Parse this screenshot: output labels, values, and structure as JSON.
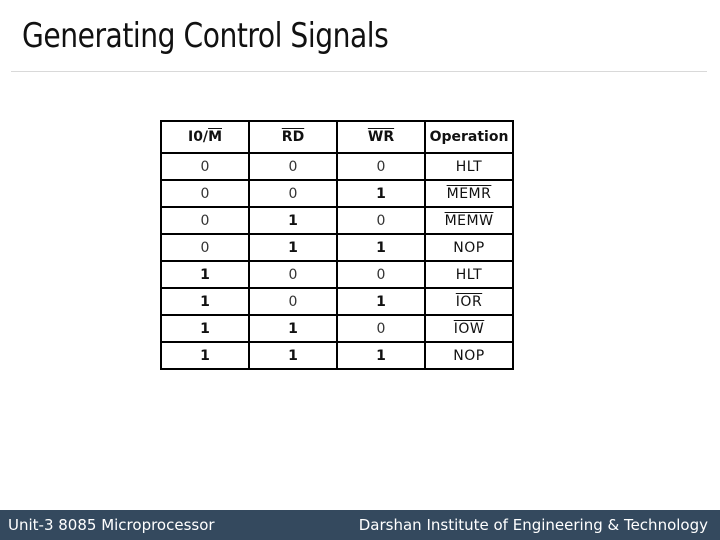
{
  "slide": {
    "title": "Generating Control Signals"
  },
  "table": {
    "headers": [
      {
        "prefix": "I0/",
        "overlined": "M"
      },
      {
        "prefix": "",
        "overlined": "RD"
      },
      {
        "prefix": "",
        "overlined": "WR"
      },
      {
        "prefix": "Operation",
        "overlined": ""
      }
    ],
    "rows": [
      {
        "io_m": "0",
        "rd": "0",
        "wr": "0",
        "op": "HLT",
        "op_overlined": false
      },
      {
        "io_m": "0",
        "rd": "0",
        "wr": "1",
        "op": "MEMR",
        "op_overlined": true
      },
      {
        "io_m": "0",
        "rd": "1",
        "wr": "0",
        "op": "MEMW",
        "op_overlined": true
      },
      {
        "io_m": "0",
        "rd": "1",
        "wr": "1",
        "op": "NOP",
        "op_overlined": false
      },
      {
        "io_m": "1",
        "rd": "0",
        "wr": "0",
        "op": "HLT",
        "op_overlined": false
      },
      {
        "io_m": "1",
        "rd": "0",
        "wr": "1",
        "op": "IOR",
        "op_overlined": true
      },
      {
        "io_m": "1",
        "rd": "1",
        "wr": "0",
        "op": "IOW",
        "op_overlined": true
      },
      {
        "io_m": "1",
        "rd": "1",
        "wr": "1",
        "op": "NOP",
        "op_overlined": false
      }
    ]
  },
  "footer": {
    "left": "Unit-3 8085 Microprocessor",
    "right": "Darshan Institute of Engineering & Technology",
    "background": "#34495e"
  }
}
